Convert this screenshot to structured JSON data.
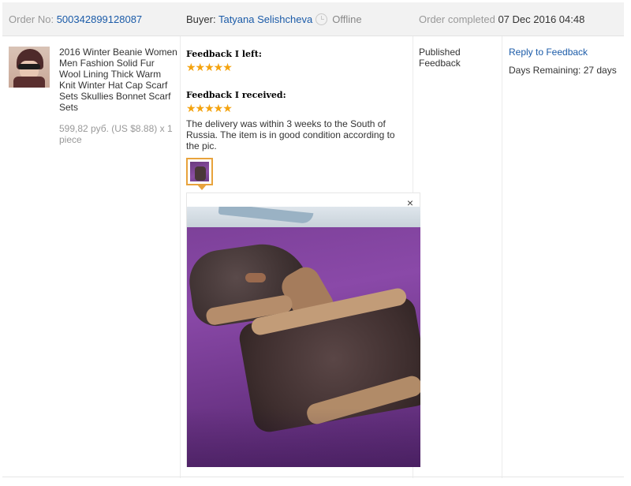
{
  "header": {
    "order_label": "Order No:",
    "order_number": "500342899128087",
    "buyer_label": "Buyer:",
    "buyer_name": "Tatyana Selishcheva",
    "buyer_status": "Offline",
    "completed_label": "Order completed",
    "completed_date": "07 Dec 2016 04:48"
  },
  "product": {
    "title": "2016 Winter Beanie Women Men Fashion Solid Fur Wool Lining Thick Warm Knit Winter Hat Cap Scarf Sets Skullies Bonnet Scarf Sets",
    "price": "599,82 руб. (US $8.88) x 1 piece"
  },
  "feedback": {
    "left_label": "Feedback I left:",
    "left_rating": "★★★★★",
    "received_label": "Feedback I received:",
    "received_rating": "★★★★★",
    "comment": "The delivery was within 3 weeks to the South of Russia. The item is in good condition according to the pic.",
    "close_symbol": "×"
  },
  "status": {
    "text": "Published Feedback"
  },
  "actions": {
    "reply_label": "Reply to Feedback",
    "days_remaining": "Days Remaining: 27 days"
  },
  "colors": {
    "link": "#1b5ba8",
    "star": "#f4a30f",
    "thumb_border": "#e8a33c",
    "header_bg": "#f2f2f2"
  },
  "icons": [
    "clock-icon",
    "star-icon",
    "close-icon"
  ]
}
